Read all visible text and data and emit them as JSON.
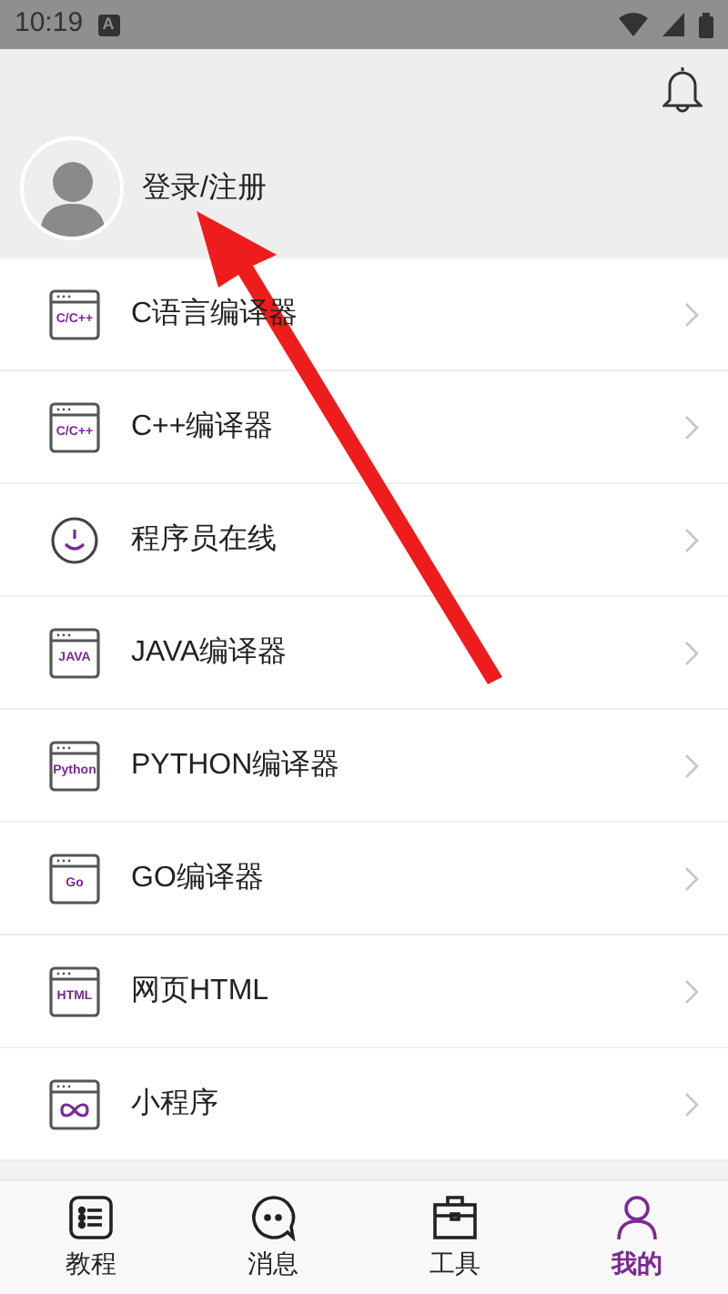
{
  "status_bar": {
    "time": "10:19",
    "indicator": "A"
  },
  "profile": {
    "login_label": "登录/注册"
  },
  "menu_items": [
    {
      "label": "C语言编译器",
      "kind": "window",
      "icon_label": "C/C++"
    },
    {
      "label": "C++编译器",
      "kind": "window",
      "icon_label": "C/C++"
    },
    {
      "label": "程序员在线",
      "kind": "smile"
    },
    {
      "label": "JAVA编译器",
      "kind": "window",
      "icon_label": "JAVA"
    },
    {
      "label": "PYTHON编译器",
      "kind": "window",
      "icon_label": "Python"
    },
    {
      "label": "GO编译器",
      "kind": "window",
      "icon_label": "Go"
    },
    {
      "label": "网页HTML",
      "kind": "window",
      "icon_label": "HTML"
    },
    {
      "label": "小程序",
      "kind": "loop"
    }
  ],
  "bottom_nav": [
    {
      "label": "教程",
      "kind": "list",
      "selected": false
    },
    {
      "label": "消息",
      "kind": "chat",
      "selected": false
    },
    {
      "label": "工具",
      "kind": "toolbox",
      "selected": false
    },
    {
      "label": "我的",
      "kind": "person",
      "selected": true
    }
  ]
}
